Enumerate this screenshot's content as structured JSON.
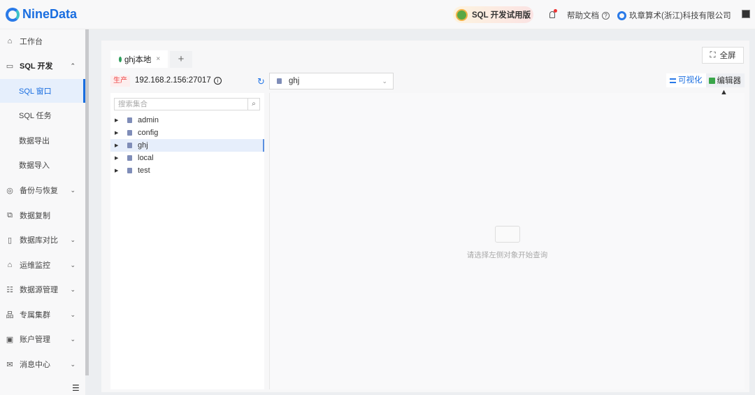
{
  "header": {
    "brand": "NineData",
    "trial": "SQL 开发试用版",
    "help": "帮助文档",
    "org": "玖章算术(浙江)科技有限公司"
  },
  "sidebar": {
    "items": [
      {
        "label": "工作台",
        "icon": "home-icon"
      },
      {
        "label": "SQL 开发",
        "icon": "monitor-icon",
        "expanded": true
      },
      {
        "label": "SQL 窗口",
        "sub": true,
        "active": true
      },
      {
        "label": "SQL 任务",
        "sub": true
      },
      {
        "label": "数据导出",
        "sub": true
      },
      {
        "label": "数据导入",
        "sub": true
      },
      {
        "label": "备份与恢复",
        "icon": "backup-icon",
        "chevron": true
      },
      {
        "label": "数据复制",
        "icon": "replicate-icon"
      },
      {
        "label": "数据库对比",
        "icon": "compare-icon",
        "chevron": true
      },
      {
        "label": "运维监控",
        "icon": "monitor-alarm-icon",
        "chevron": true
      },
      {
        "label": "数据源管理",
        "icon": "datasource-icon",
        "chevron": true
      },
      {
        "label": "专属集群",
        "icon": "cluster-icon",
        "chevron": true
      },
      {
        "label": "账户管理",
        "icon": "account-icon",
        "chevron": true
      },
      {
        "label": "消息中心",
        "icon": "mail-icon",
        "chevron": true
      }
    ]
  },
  "tabs": [
    {
      "label": "ghj本地",
      "close": "×"
    }
  ],
  "tab_add": "+",
  "fullscreen": "全屏",
  "conn": {
    "env": "生产",
    "host": "192.168.2.156:27017",
    "database": "ghj"
  },
  "mode": {
    "visual": "可视化",
    "editor": "编辑器"
  },
  "tree": {
    "search_placeholder": "搜索集合",
    "nodes": [
      "admin",
      "config",
      "ghj",
      "local",
      "test"
    ],
    "selected": "ghj"
  },
  "empty": "请选择左侧对象开始查询"
}
